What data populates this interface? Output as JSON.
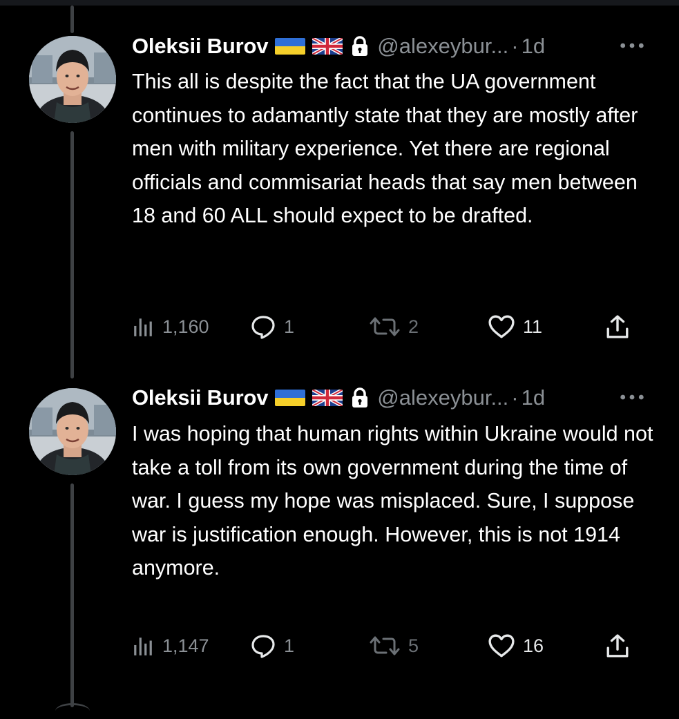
{
  "tweets": [
    {
      "author": {
        "name": "Oleksii Burov",
        "handle": "@alexeybur...",
        "flags": [
          "ukraine-flag",
          "uk-flag"
        ],
        "protected": true
      },
      "separator": "·",
      "time": "1d",
      "text": "This all is despite the fact that the UA government continues to adamantly state that they are mostly after men with military experience. Yet there are regional officials and commisariat heads that say men between 18 and 60 ALL should expect to be drafted.",
      "stats": {
        "views": "1,160",
        "replies": "1",
        "retweets": "2",
        "likes": "11"
      }
    },
    {
      "author": {
        "name": "Oleksii Burov",
        "handle": "@alexeybur...",
        "flags": [
          "ukraine-flag",
          "uk-flag"
        ],
        "protected": true
      },
      "separator": "·",
      "time": "1d",
      "text": "I was hoping that human rights within Ukraine would not take a toll from its own government during the time of war. I guess my hope was misplaced. Sure, I suppose war is justification enough. However, this is not 1914 anymore.",
      "stats": {
        "views": "1,147",
        "replies": "1",
        "retweets": "5",
        "likes": "16"
      }
    }
  ],
  "colors": {
    "background": "#000000",
    "text": "#ffffff",
    "secondary": "#8b9095",
    "thread_line": "#3e4144"
  },
  "icons": [
    "views-icon",
    "reply-icon",
    "retweet-icon",
    "like-icon",
    "share-icon",
    "more-icon",
    "lock-icon"
  ]
}
